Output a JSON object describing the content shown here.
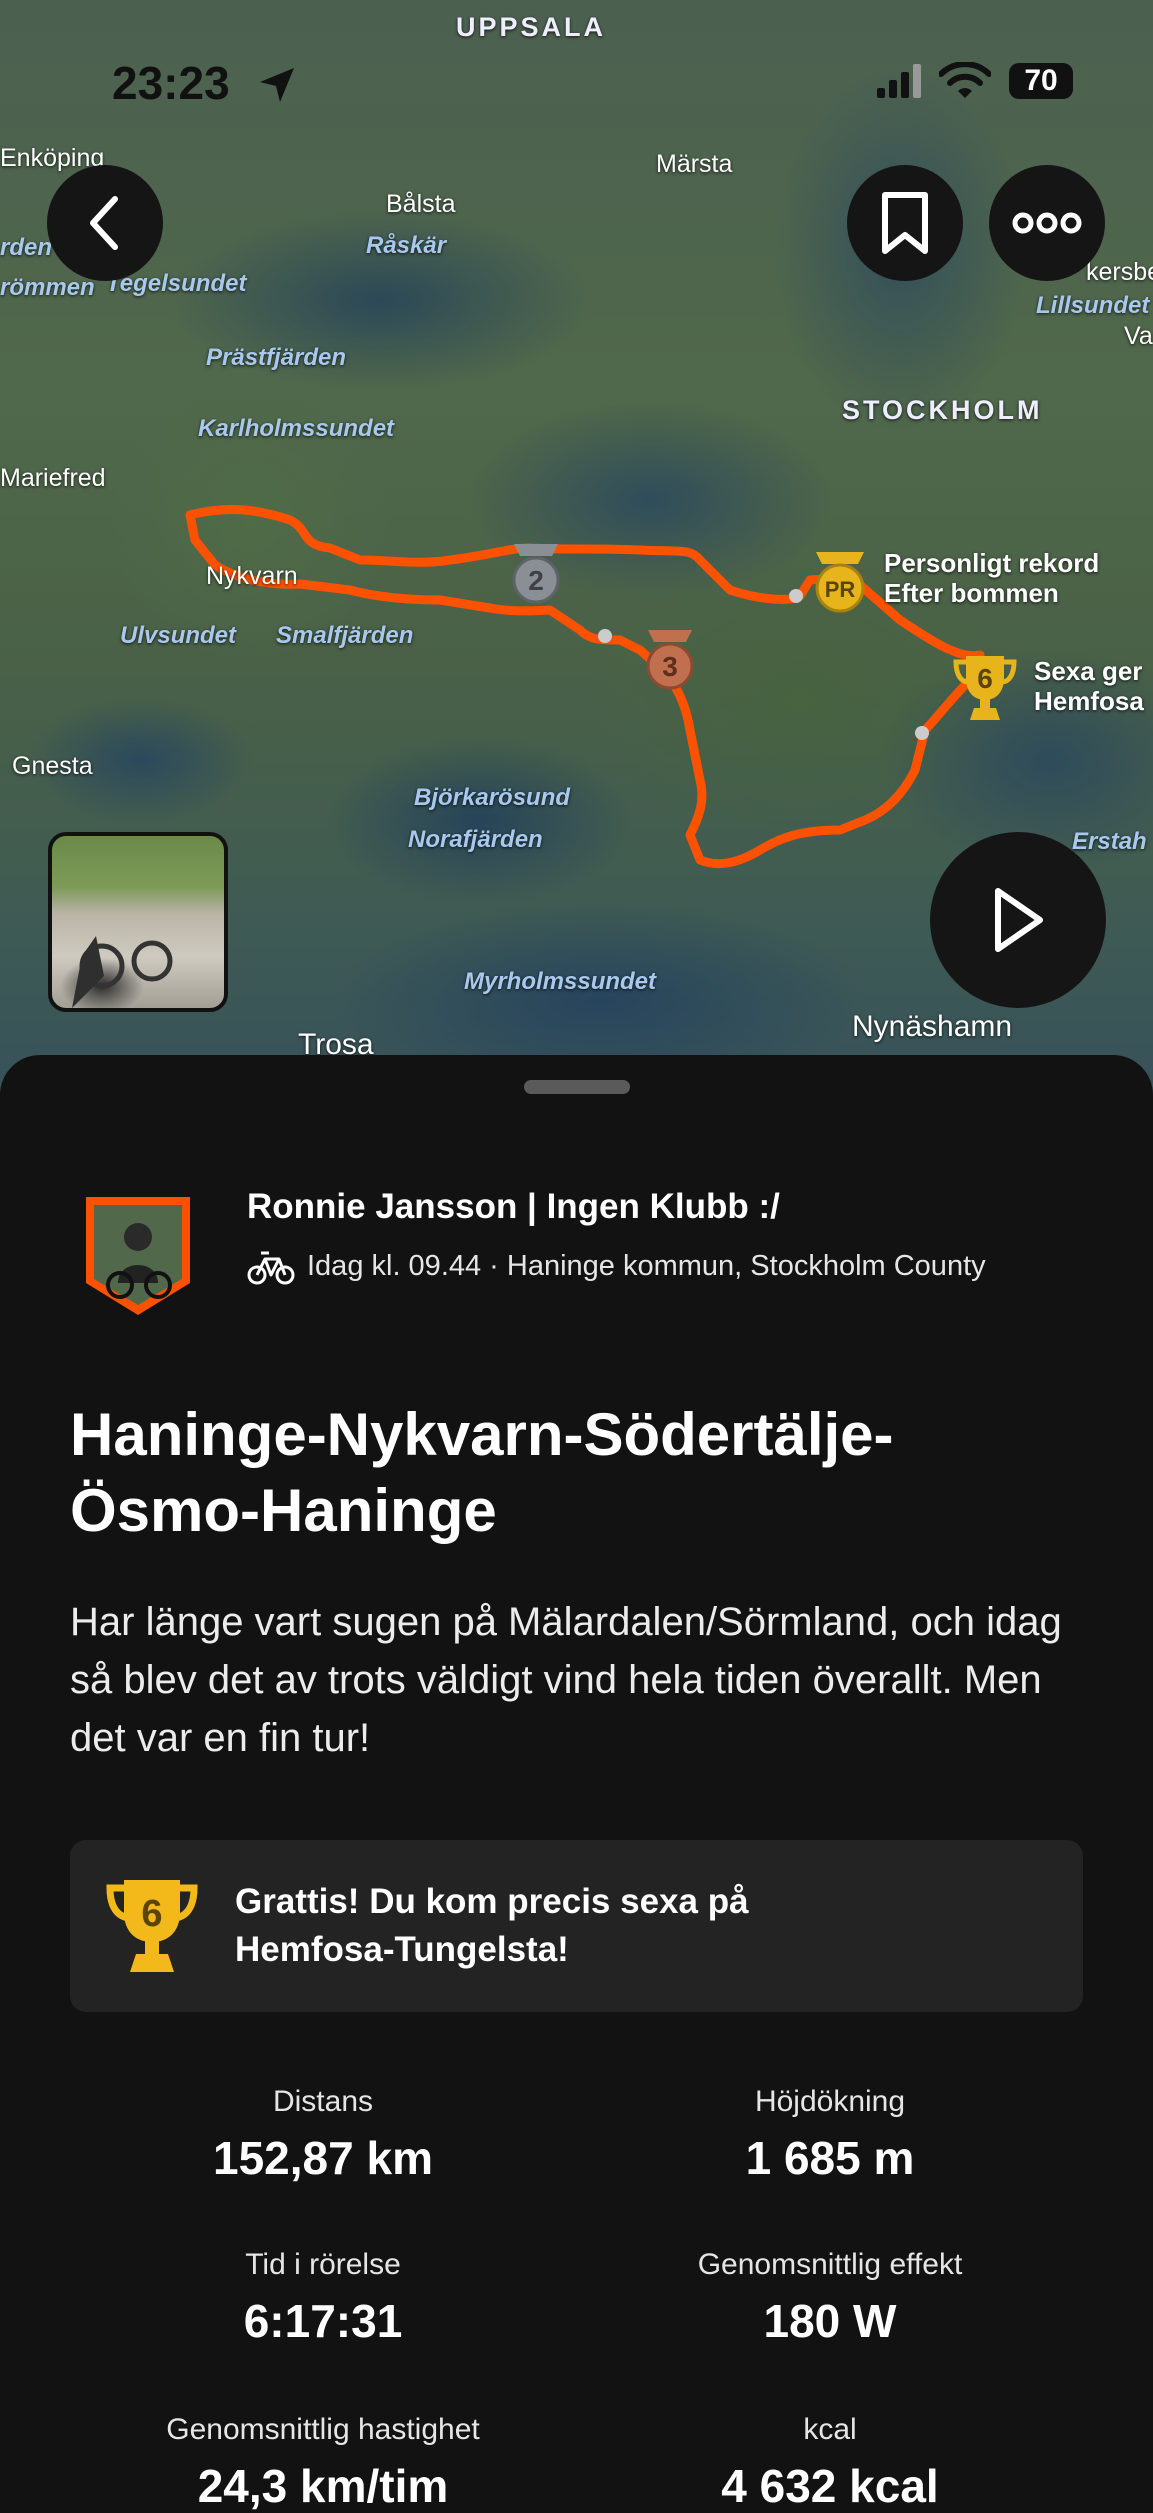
{
  "status_bar": {
    "time": "23:23",
    "battery": "70"
  },
  "map": {
    "places": {
      "uppsala": "UPPSALA",
      "enkoping": "Enköping",
      "marsta": "Märsta",
      "balsta": "Bålsta",
      "raskar": "Råskär",
      "arden": "rden",
      "rommen": "römmen",
      "tegelsundet": "Tegelsundet",
      "kersbe": "kersbe",
      "lillsundet": "Lillsundet",
      "va": "Va",
      "prastfjarden": "Prästfjärden",
      "stockholm": "STOCKHOLM",
      "karlholmssundet": "Karlholmssundet",
      "mariefred": "Mariefred",
      "nykvarn": "Nykvarn",
      "ulvsundet": "Ulvsundet",
      "smalfjarden": "Smalfjärden",
      "gnesta": "Gnesta",
      "bjorkarosund": "Björkarösund",
      "norafjarden": "Norafjärden",
      "erstah": "Erstah",
      "myrholmssundet": "Myrholmssundet",
      "nynashamn": "Nynäshamn",
      "trosa": "Trosa"
    },
    "segments": {
      "pr_label_1": "Personligt rekord",
      "pr_label_2": "Efter bommen",
      "sixth_label_1": "Sexa ger",
      "sixth_label_2": "Hemfosa"
    },
    "badges": {
      "medal_2": "2",
      "medal_3": "3",
      "pr": "PR",
      "trophy_6": "6"
    },
    "route_color": "#fc5200"
  },
  "activity": {
    "athlete": "Ronnie Jansson | Ingen Klubb :/",
    "meta": "Idag kl. 09.44 · Haninge kommun, Stockholm County",
    "title": "Haninge-Nykvarn-Södertälje-Ösmo-Haninge",
    "description": "Har länge vart sugen på Mälardalen/Sörmland, och idag så blev det av trots väldigt vind hela tiden överallt. Men det var en fin tur!",
    "award": {
      "rank": "6",
      "text": "Grattis! Du kom precis sexa på Hemfosa-Tungelsta!"
    },
    "stats": [
      {
        "label": "Distans",
        "value": "152,87 km"
      },
      {
        "label": "Höjdökning",
        "value": "1 685 m"
      },
      {
        "label": "Tid i rörelse",
        "value": "6:17:31"
      },
      {
        "label": "Genomsnittlig effekt",
        "value": "180 W"
      },
      {
        "label": "Genomsnittlig hastighet",
        "value": "24,3 km/tim"
      },
      {
        "label": "kcal",
        "value": "4 632 kcal"
      }
    ]
  }
}
